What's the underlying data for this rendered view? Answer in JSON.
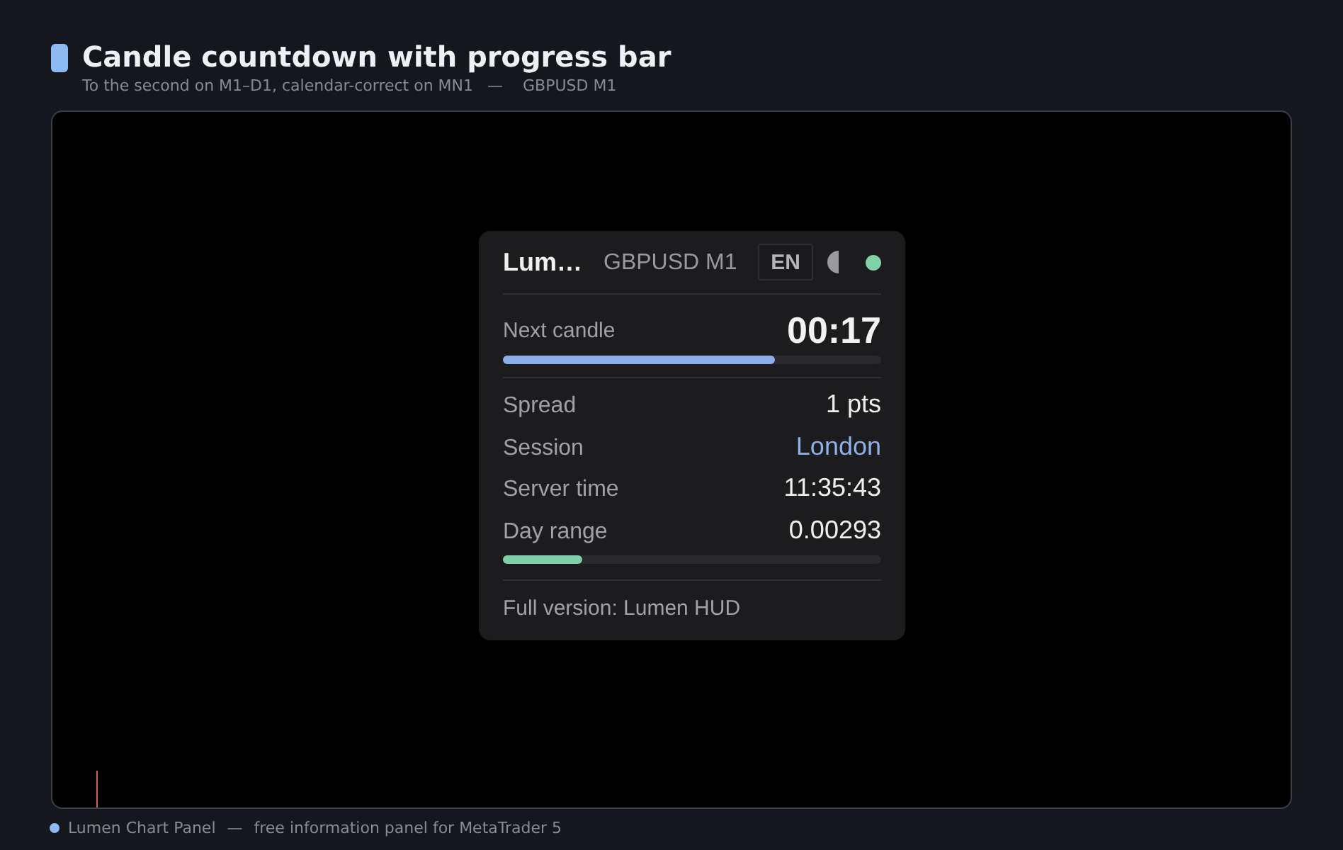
{
  "header": {
    "title": "Candle countdown with progress bar",
    "subtitle": {
      "description": "To the second on M1–D1, calendar-correct on MN1",
      "separator": "—",
      "symbol": "GBPUSD M1"
    }
  },
  "panel": {
    "title": "Lum…",
    "symbol": "GBPUSD M1",
    "language": "EN",
    "connected": true,
    "countdown": {
      "label": "Next candle",
      "value": "00:17",
      "level": 0.72
    },
    "rows": [
      {
        "kind": "plain",
        "label": "Spread",
        "value": "1 pts",
        "accent": false
      },
      {
        "kind": "plain",
        "label": "Session",
        "value": "London",
        "accent": true
      },
      {
        "kind": "plain",
        "label": "Server time",
        "value": "11:35:43",
        "accent": false
      },
      {
        "kind": "meter",
        "label": "Day range",
        "value": "0.00293",
        "accent": false,
        "level": 0.21
      }
    ],
    "footer": "Full version: Lumen HUD"
  },
  "footer": {
    "name": "Lumen Chart Panel",
    "separator": "—",
    "tagline": "free information panel for MetaTrader 5"
  }
}
